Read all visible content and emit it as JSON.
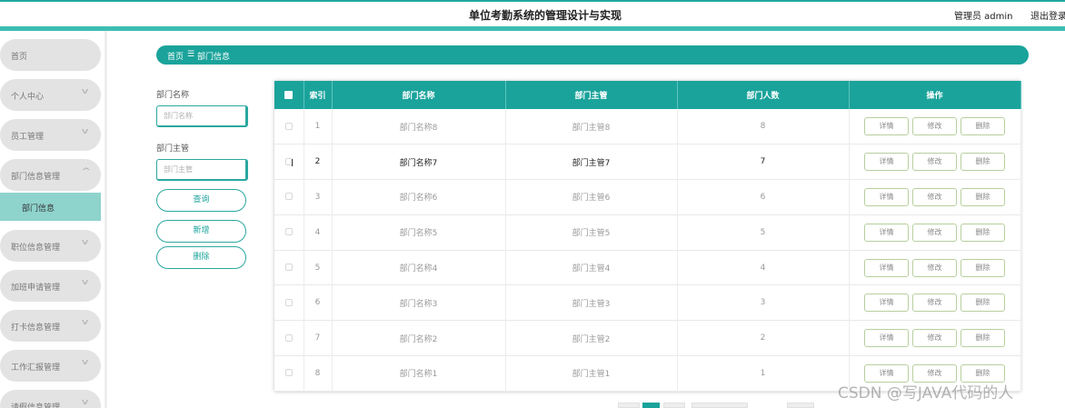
{
  "header": {
    "title": "单位考勤系统的管理设计与实现",
    "admin_label": "管理员 admin",
    "logout_label": "退出登录"
  },
  "sidebar": {
    "items": [
      {
        "label": "首页",
        "expandable": false
      },
      {
        "label": "个人中心",
        "expandable": true
      },
      {
        "label": "员工管理",
        "expandable": true
      },
      {
        "label": "部门信息管理",
        "expandable": true,
        "expanded": true
      },
      {
        "label": "职位信息管理",
        "expandable": true
      },
      {
        "label": "加班申请管理",
        "expandable": true
      },
      {
        "label": "打卡信息管理",
        "expandable": true
      },
      {
        "label": "工作汇报管理",
        "expandable": true
      },
      {
        "label": "请假信息管理",
        "expandable": true
      }
    ],
    "active_sub": "部门信息"
  },
  "breadcrumb": {
    "home": "首页",
    "separator": "☰",
    "current": "部门信息"
  },
  "search": {
    "name_label": "部门名称",
    "name_placeholder": "部门名称",
    "manager_label": "部门主管",
    "manager_placeholder": "部门主管",
    "query_button": "查询",
    "add_button": "新增",
    "delete_button": "删除"
  },
  "table": {
    "columns": [
      "索引",
      "部门名称",
      "部门主管",
      "部门人数",
      "操作"
    ],
    "rows": [
      {
        "index": "1",
        "name": "部门名称8",
        "manager": "部门主管8",
        "count": "8"
      },
      {
        "index": "2",
        "name": "部门名称7",
        "manager": "部门主管7",
        "count": "7"
      },
      {
        "index": "3",
        "name": "部门名称6",
        "manager": "部门主管6",
        "count": "6"
      },
      {
        "index": "4",
        "name": "部门名称5",
        "manager": "部门主管5",
        "count": "5"
      },
      {
        "index": "5",
        "name": "部门名称4",
        "manager": "部门主管4",
        "count": "4"
      },
      {
        "index": "6",
        "name": "部门名称3",
        "manager": "部门主管3",
        "count": "3"
      },
      {
        "index": "7",
        "name": "部门名称2",
        "manager": "部门主管2",
        "count": "2"
      },
      {
        "index": "8",
        "name": "部门名称1",
        "manager": "部门主管1",
        "count": "1"
      }
    ],
    "actions": {
      "detail": "详情",
      "edit": "修改",
      "delete": "删除"
    },
    "hovered_row": 1
  },
  "watermark": "CSDN @写JAVA代码的人",
  "colors": {
    "accent": "#1aa39b",
    "header_bar": "#3dbdb3",
    "sidebar_item": "#e3e3e3",
    "active_sub": "#8fd3cd"
  }
}
